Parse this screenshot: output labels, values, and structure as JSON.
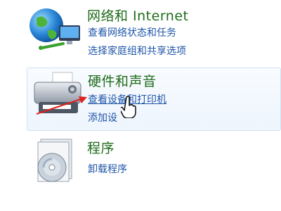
{
  "categories": {
    "network": {
      "title": "网络和 Internet",
      "links": [
        "查看网络状态和任务",
        "选择家庭组和共享选项"
      ],
      "icon": "network-globe-icon"
    },
    "hardware": {
      "title": "硬件和声音",
      "links": [
        "查看设备和打印机",
        "添加设"
      ],
      "icon": "printer-icon"
    },
    "programs": {
      "title": "程序",
      "links": [
        "卸载程序"
      ],
      "icon": "programs-disc-icon"
    }
  },
  "annotation": {
    "arrow_color": "#e0221f"
  },
  "cursor": "hand-pointer-icon"
}
